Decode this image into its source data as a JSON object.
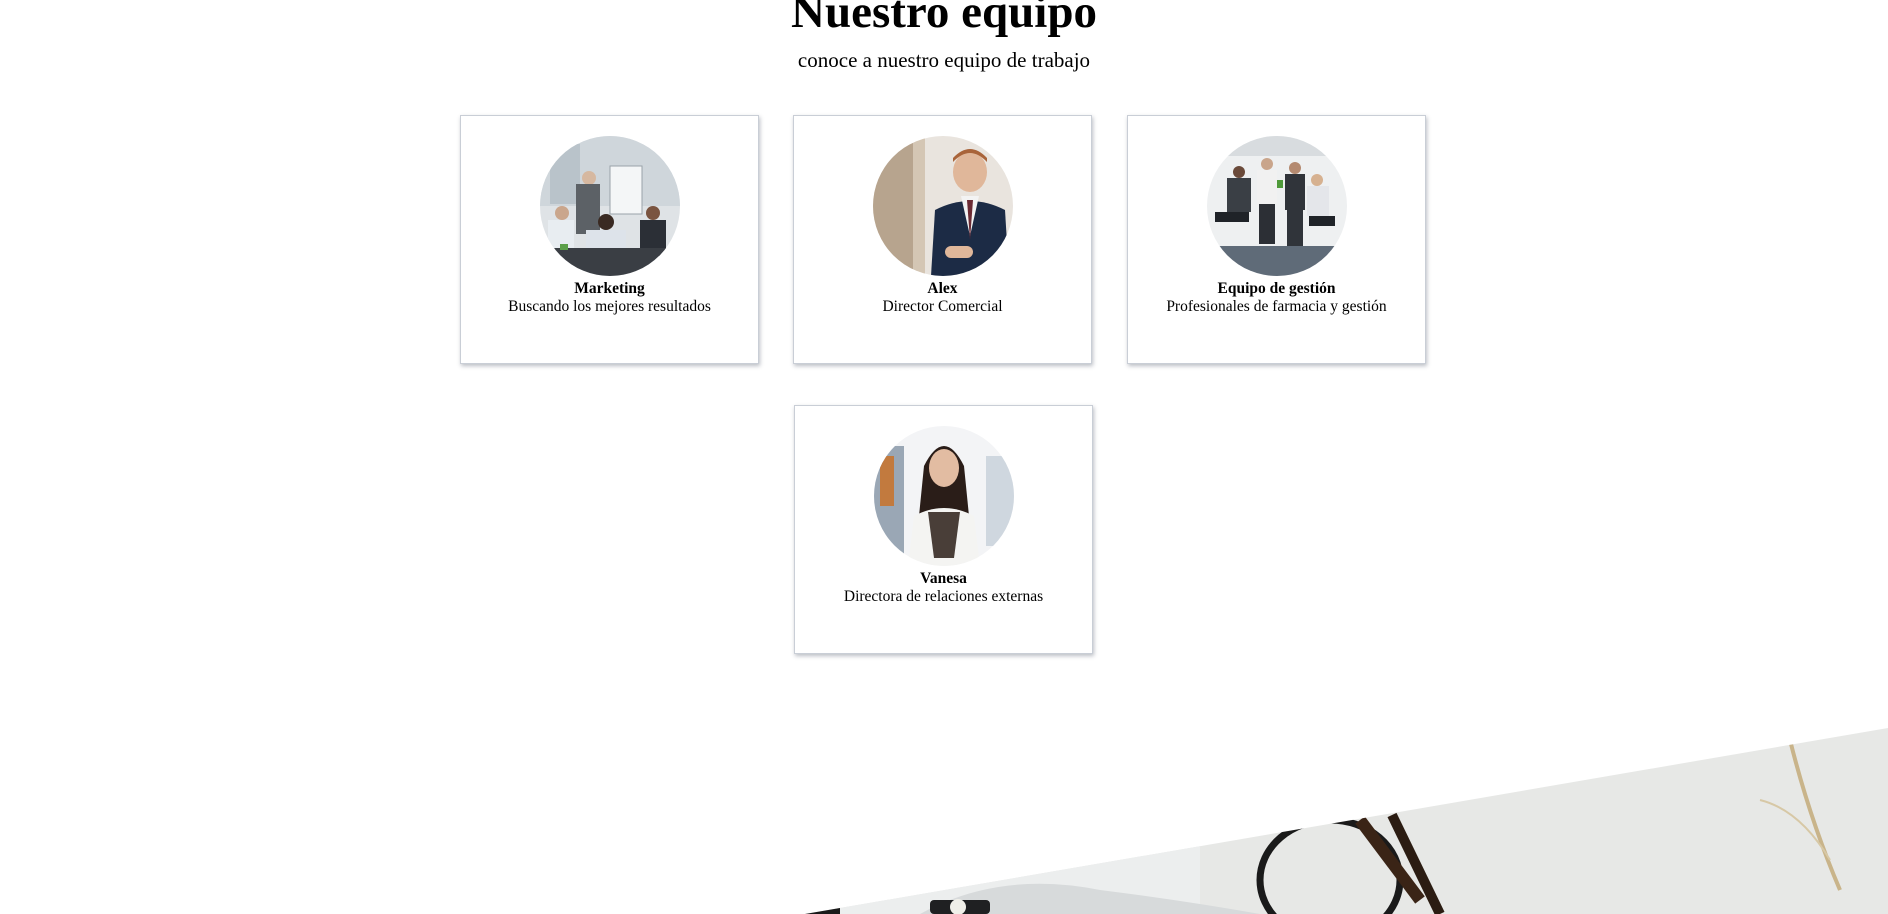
{
  "section": {
    "title": "Nuestro equipo",
    "subtitle": "conoce a nuestro equipo de trabajo"
  },
  "team": [
    {
      "name": "Marketing",
      "role": "Buscando los mejores resultados",
      "photo_icon": "group-presentation-photo"
    },
    {
      "name": "Alex",
      "role": "Director Comercial",
      "photo_icon": "man-in-suit-photo"
    },
    {
      "name": "Equipo de gestión",
      "role": "Profesionales de farmacia y gestión",
      "photo_icon": "management-team-photo"
    },
    {
      "name": "Vanesa",
      "role": "Directora de relaciones externas",
      "photo_icon": "woman-portrait-photo"
    }
  ],
  "colors": {
    "card_border": "#c9ced6",
    "background": "#ffffff",
    "text": "#000000"
  }
}
